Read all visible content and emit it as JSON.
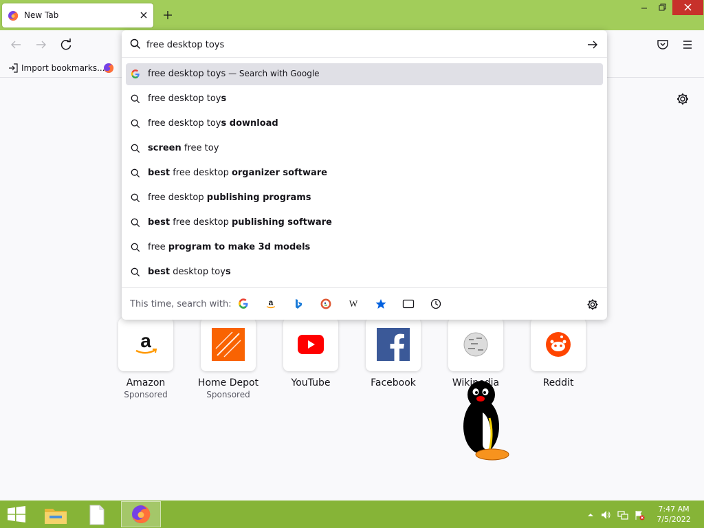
{
  "browser": {
    "tab": {
      "title": "New Tab"
    },
    "bookmarks": {
      "import_label": "Import bookmarks..."
    }
  },
  "urlbar": {
    "value": "free desktop toys",
    "results": [
      {
        "icon": "google-icon",
        "plain_before": "free desktop toys",
        "bold": "",
        "plain_after": "",
        "action": " — Search with Google"
      },
      {
        "icon": "search-icon",
        "plain_before": "free desktop toy",
        "bold": "s",
        "plain_after": "",
        "action": ""
      },
      {
        "icon": "search-icon",
        "plain_before": "free desktop toy",
        "bold": "s download",
        "plain_after": "",
        "action": ""
      },
      {
        "icon": "search-icon",
        "plain_before": "",
        "bold": "screen",
        "plain_after": " free toy",
        "action": ""
      },
      {
        "icon": "search-icon",
        "plain_before": "",
        "bold": "best",
        "plain_after": " free desktop ",
        "bold2": "organizer software",
        "action": ""
      },
      {
        "icon": "search-icon",
        "plain_before": "free desktop ",
        "bold": "publishing programs",
        "plain_after": "",
        "action": ""
      },
      {
        "icon": "search-icon",
        "plain_before": "",
        "bold": "best",
        "plain_after": " free desktop ",
        "bold2": "publishing software",
        "action": ""
      },
      {
        "icon": "search-icon",
        "plain_before": "free ",
        "bold": "program to make 3d models",
        "plain_after": "",
        "action": ""
      },
      {
        "icon": "search-icon",
        "plain_before": "",
        "bold": "best",
        "plain_after": " desktop toy",
        "bold2": "s",
        "action": ""
      }
    ],
    "oneoff": {
      "label": "This time, search with:",
      "engines": [
        "google-icon",
        "amazon-icon",
        "bing-icon",
        "duckduckgo-icon",
        "wikipedia-icon",
        "bookmarks-star-icon",
        "tabs-icon",
        "history-icon"
      ]
    }
  },
  "top_sites": [
    {
      "name": "Amazon",
      "sponsored": "Sponsored",
      "icon": "amazon-logo"
    },
    {
      "name": "Home Depot",
      "sponsored": "Sponsored",
      "icon": "home-depot-logo"
    },
    {
      "name": "YouTube",
      "sponsored": "",
      "icon": "youtube-logo"
    },
    {
      "name": "Facebook",
      "sponsored": "",
      "icon": "facebook-logo"
    },
    {
      "name": "Wikipedia",
      "sponsored": "",
      "icon": "wikipedia-logo"
    },
    {
      "name": "Reddit",
      "sponsored": "",
      "icon": "reddit-logo"
    }
  ],
  "taskbar": {
    "time": "7:47 AM",
    "date": "7/5/2022"
  },
  "colors": {
    "titlebar": "#a2cd5a",
    "taskbar": "#86b437",
    "close_button": "#c7312b",
    "selected_result": "#e0e0e6"
  }
}
